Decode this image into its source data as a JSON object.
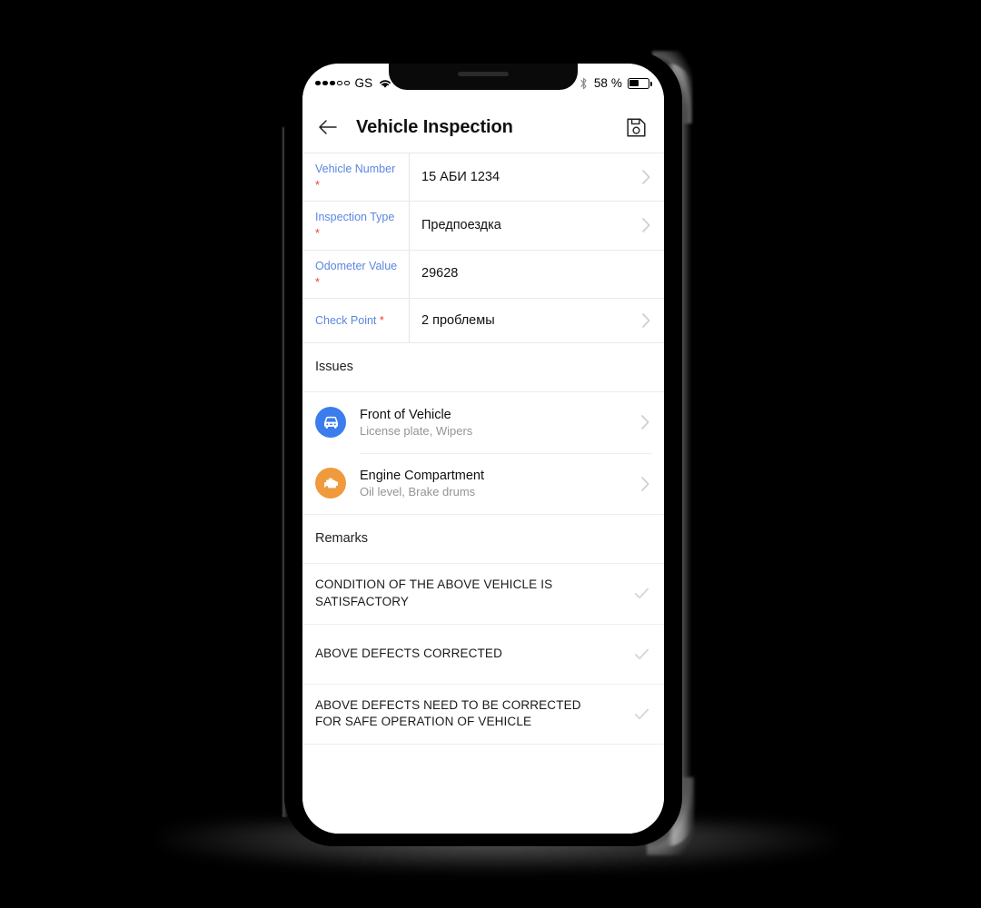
{
  "device": {
    "type": "smartphone-mockup",
    "frame_color": "#000000",
    "screen_background": "#ffffff"
  },
  "status_bar": {
    "signal_dots_filled": 3,
    "signal_dots_total": 5,
    "carrier": "GS",
    "wifi_icon": "wifi-icon",
    "bluetooth_icon": "bluetooth-icon",
    "battery_percent_label": "58 %",
    "battery_level": 45
  },
  "app_bar": {
    "back_icon": "arrow-left-icon",
    "title": "Vehicle Inspection",
    "save_icon": "floppy-save-icon"
  },
  "form": {
    "required_marker": "*",
    "rows": [
      {
        "label": "Vehicle Number",
        "required": true,
        "value": "15 АБИ 1234",
        "has_chevron": true
      },
      {
        "label": "Inspection Type",
        "required": true,
        "value": "Предпоездка",
        "has_chevron": true
      },
      {
        "label": "Odometer Value",
        "required": true,
        "value": "29628",
        "has_chevron": false
      },
      {
        "label": "Check Point",
        "required": true,
        "value": "2 проблемы",
        "has_chevron": true
      }
    ]
  },
  "issues_section": {
    "header": "Issues",
    "items": [
      {
        "icon": "car-front-icon",
        "icon_color": "#3b7ded",
        "title": "Front of Vehicle",
        "subtitle": "License plate, Wipers"
      },
      {
        "icon": "engine-icon",
        "icon_color": "#ef9a3d",
        "title": "Engine Compartment",
        "subtitle": "Oil level, Brake drums"
      }
    ]
  },
  "remarks_section": {
    "header": "Remarks",
    "items": [
      {
        "text": "CONDITION OF THE ABOVE VEHICLE IS SATISFACTORY",
        "check_icon": "check-icon"
      },
      {
        "text": "ABOVE DEFECTS CORRECTED",
        "check_icon": "check-icon"
      },
      {
        "text": "ABOVE DEFECTS NEED TO BE CORRECTED FOR SAFE OPERATION OF VEHICLE",
        "check_icon": "check-icon"
      }
    ]
  },
  "colors": {
    "label_blue": "#5b86e0",
    "required_red": "#f0412f",
    "chevron_gray": "#cfcfcf",
    "check_gray": "#d8d8d8",
    "divider": "#e9e9e9"
  }
}
